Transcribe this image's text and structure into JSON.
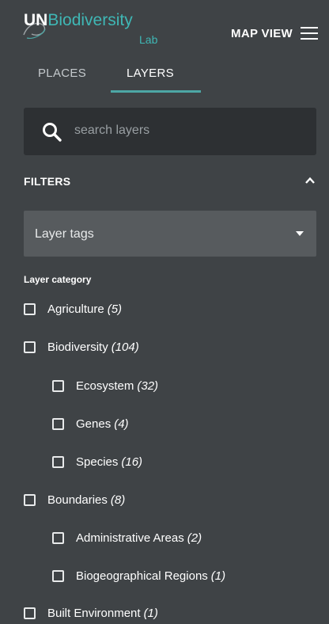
{
  "header": {
    "logo_un": "UN",
    "logo_biodiversity": "Biodiversity",
    "logo_lab": "Lab",
    "map_view_label": "MAP VIEW"
  },
  "tabs": [
    {
      "label": "PLACES",
      "active": false
    },
    {
      "label": "LAYERS",
      "active": true
    }
  ],
  "search": {
    "placeholder": "search layers"
  },
  "filters": {
    "title": "FILTERS",
    "expanded": true,
    "layer_tags_label": "Layer tags",
    "category_title": "Layer category",
    "categories": [
      {
        "label": "Agriculture",
        "count": "(5)",
        "level": 0,
        "checked": false
      },
      {
        "label": "Biodiversity",
        "count": "(104)",
        "level": 0,
        "checked": false
      },
      {
        "label": "Ecosystem",
        "count": "(32)",
        "level": 1,
        "checked": false
      },
      {
        "label": "Genes",
        "count": "(4)",
        "level": 1,
        "checked": false
      },
      {
        "label": "Species",
        "count": "(16)",
        "level": 1,
        "checked": false
      },
      {
        "label": "Boundaries",
        "count": "(8)",
        "level": 0,
        "checked": false
      },
      {
        "label": "Administrative Areas",
        "count": "(2)",
        "level": 1,
        "checked": false
      },
      {
        "label": "Biogeographical Regions",
        "count": "(1)",
        "level": 1,
        "checked": false
      },
      {
        "label": "Built Environment",
        "count": "(1)",
        "level": 0,
        "checked": false
      }
    ]
  },
  "colors": {
    "background": "#3f4346",
    "search_background": "#2d3033",
    "select_background": "#575b5e",
    "accent": "#4da7a5"
  },
  "icons": {
    "logo": "un-biodiversity-lab-logo",
    "menu": "hamburger-icon",
    "search": "search-icon",
    "collapse": "chevron-up-icon",
    "dropdown": "caret-down-icon",
    "checkbox": "checkbox-unchecked-icon"
  }
}
